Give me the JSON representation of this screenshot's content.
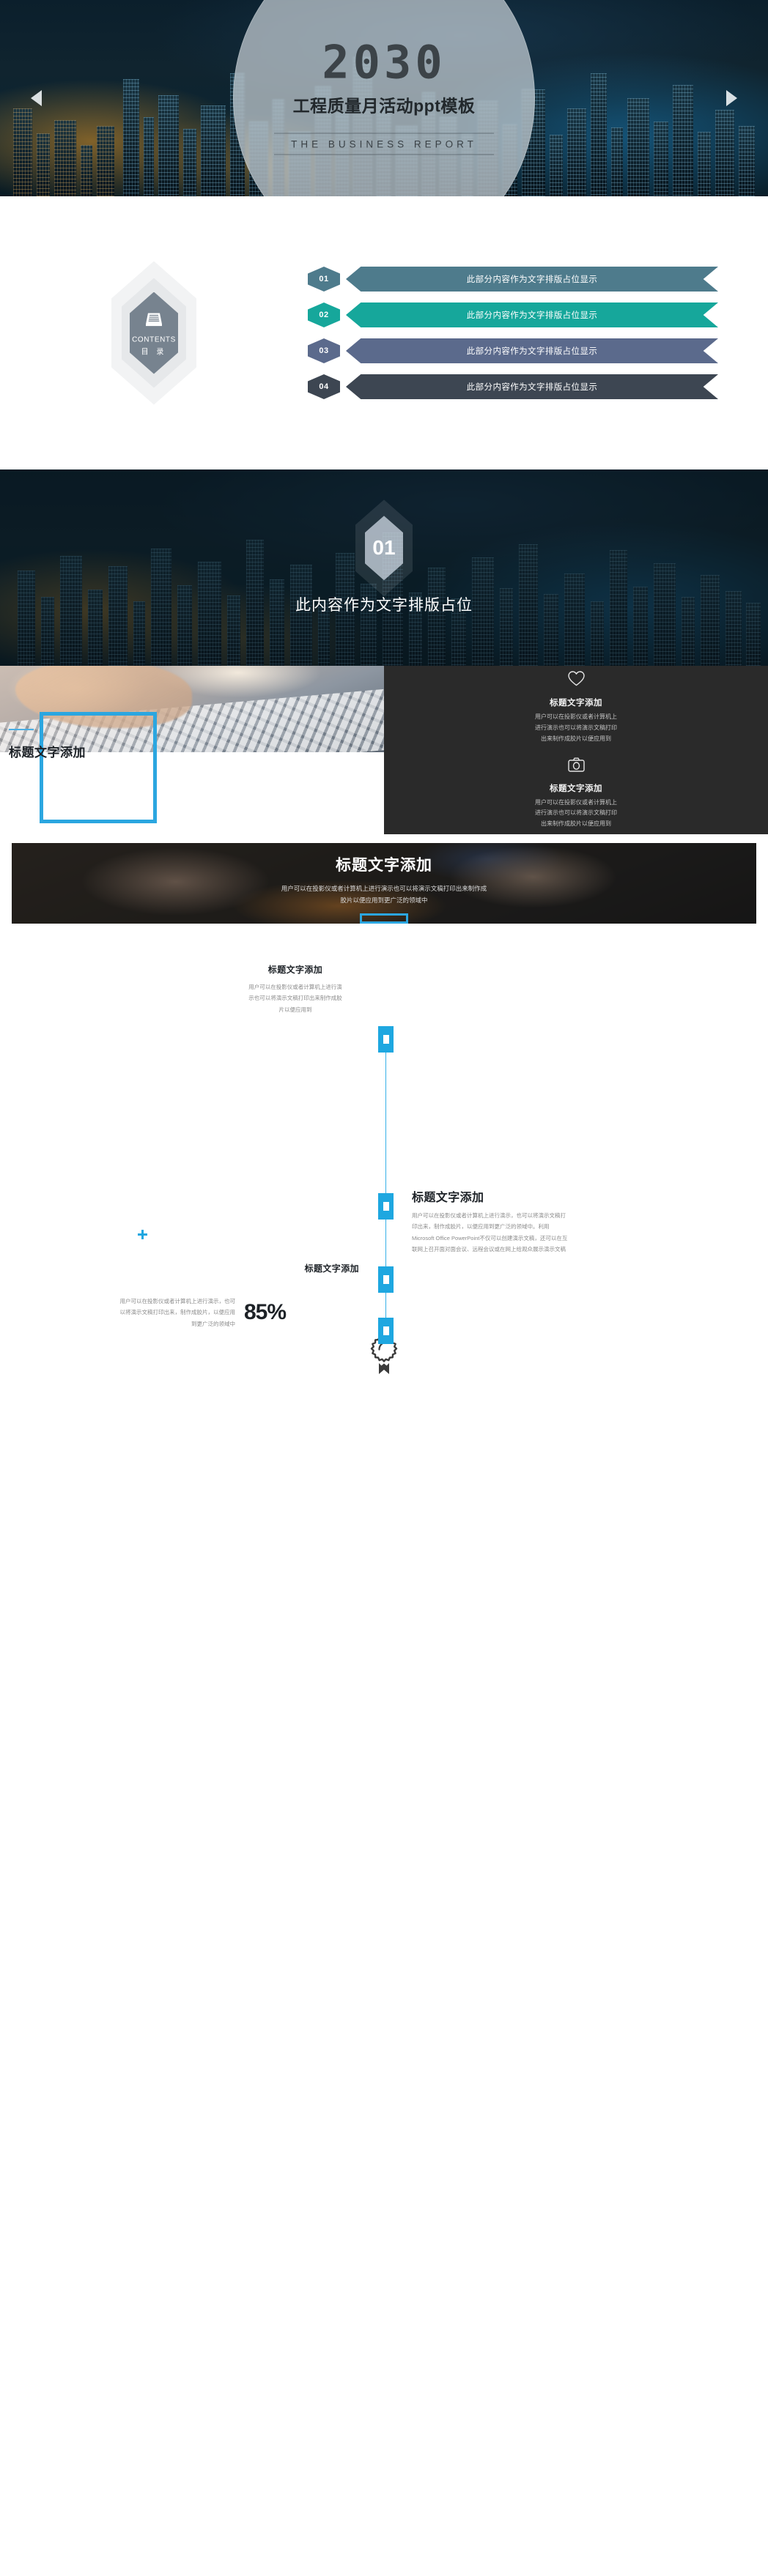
{
  "slide_cover": {
    "year": "2030",
    "title": "工程质量月活动ppt模板",
    "subtitle": "THE BUSINESS REPORT",
    "nav_prev_icon": "triangle-left-icon",
    "nav_next_icon": "triangle-right-icon"
  },
  "slide_contents": {
    "badge_icon": "file-box-icon",
    "badge_en": "CONTENTS",
    "badge_cn": "目 录",
    "items": [
      {
        "num": "01",
        "label": "此部分内容作为文字排版占位显示",
        "color": "#4e7b8c"
      },
      {
        "num": "02",
        "label": "此部分内容作为文字排版占位显示",
        "color": "#16a79b"
      },
      {
        "num": "03",
        "label": "此部分内容作为文字排版占位显示",
        "color": "#5b6a8c"
      },
      {
        "num": "04",
        "label": "此部分内容作为文字排版占位显示",
        "color": "#3d4652"
      }
    ]
  },
  "slide_section": {
    "number": "01",
    "caption": "此内容作为文字排版占位"
  },
  "slide_split": {
    "frame_title": "标题文字添加",
    "features": [
      {
        "icon": "heart-icon",
        "title": "标题文字添加",
        "desc_lines": [
          "用户可以在投影仪或者计算机上",
          "进行演示也可以将演示文稿打印",
          "出来制作成胶片以便应用到"
        ]
      },
      {
        "icon": "camera-icon",
        "title": "标题文字添加",
        "desc_lines": [
          "用户可以在投影仪或者计算机上",
          "进行演示也可以将演示文稿打印",
          "出来制作成胶片以便应用到"
        ]
      }
    ]
  },
  "slide_banner": {
    "title": "标题文字添加",
    "desc_lines": [
      "用户可以在投影仪或者计算机上进行演示也可以将演示文稿打印出来制作成",
      "胶片以便应用到更广泛的领域中"
    ],
    "button_label": ""
  },
  "slide_timeline": {
    "accent_color": "#1ea7e0",
    "plus_icon": "plus-icon",
    "badge_icon": "award-ribbon-icon",
    "entries": [
      {
        "title": "标题文字添加",
        "desc_lines": [
          "用户可以在投影仪或者计算机上进行演",
          "示也可以将演示文稿打印出来制作成胶",
          "片以便应用到"
        ]
      },
      {
        "title": "标题文字添加",
        "desc_lines": [
          "用户可以在投影仪或者计算机上进行演示，也可以将演示文稿打",
          "印出来，制作成胶片，以便应用到更广泛的领域中。利用",
          "Microsoft Office PowerPoint不仅可以创建演示文稿，还可以在互",
          "联网上召开面对面会议、远程会议或在网上给观众展示演示文稿"
        ]
      },
      {
        "title": "标题文字添加",
        "desc_lines": [
          "用户可以在投影仪或者计算机上进行演示，也可",
          "以将演示文稿打印出来，制作成胶片，以便应用",
          "到更广泛的领域中"
        ],
        "stat": "85%"
      }
    ]
  }
}
